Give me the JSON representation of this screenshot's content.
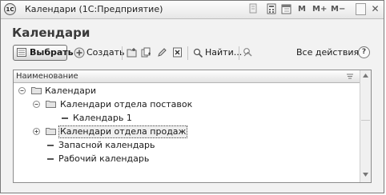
{
  "window": {
    "app_badge": "1С",
    "title": "Календари (1С:Предприятие)",
    "memory_buttons": [
      "M",
      "M+",
      "M−"
    ],
    "controls": [
      "maximize-icon",
      "close-icon"
    ]
  },
  "form": {
    "heading": "Календари"
  },
  "toolbar": {
    "select_label": "Выбрать",
    "create_label": "Создать",
    "find_label": "Найти...",
    "all_actions_label": "Все действия",
    "help_label": "?"
  },
  "table": {
    "column_header": "Наименование",
    "rows": [
      {
        "label": "Календари",
        "type": "folder",
        "expanded": true,
        "level": 0
      },
      {
        "label": "Календари отдела поставок",
        "type": "folder",
        "expanded": true,
        "level": 1
      },
      {
        "label": "Календарь 1",
        "type": "item",
        "level": 2
      },
      {
        "label": "Календари отдела продаж",
        "type": "folder",
        "expanded": false,
        "level": 1,
        "selected": true
      },
      {
        "label": "Запасной календарь",
        "type": "item",
        "level": 1
      },
      {
        "label": "Рабочий календарь",
        "type": "item",
        "level": 1
      }
    ]
  }
}
